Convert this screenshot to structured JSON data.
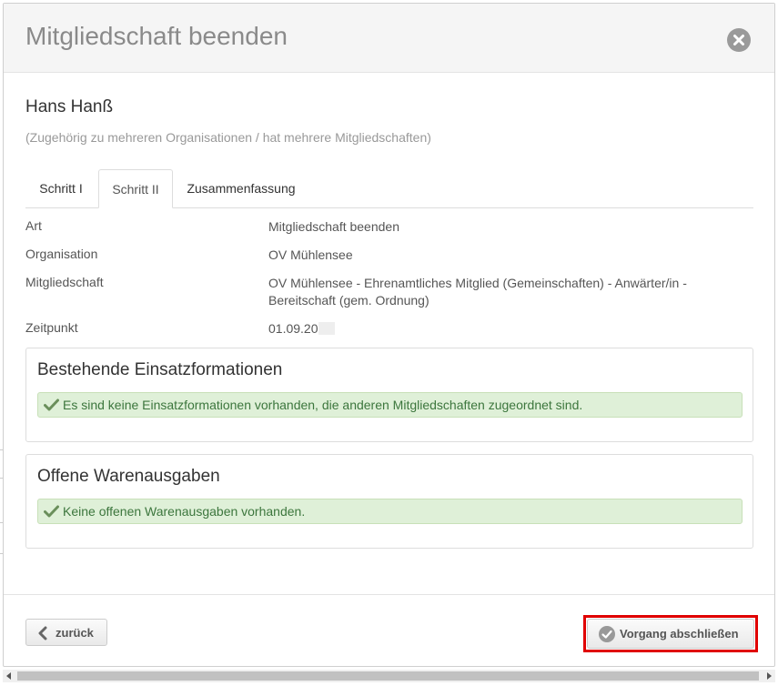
{
  "dialog": {
    "title": "Mitgliedschaft beenden",
    "close_icon": "close-icon"
  },
  "person": {
    "name": "Hans Hanß",
    "subtitle": "(Zugehörig zu mehreren Organisationen / hat mehrere Mitgliedschaften)"
  },
  "tabs": [
    {
      "label": "Schritt I",
      "active": false
    },
    {
      "label": "Schritt II",
      "active": true
    },
    {
      "label": "Zusammenfassung",
      "active": false
    }
  ],
  "details": {
    "art": {
      "label": "Art",
      "value": "Mitgliedschaft beenden"
    },
    "organisation": {
      "label": "Organisation",
      "value": "OV Mühlensee"
    },
    "mitgliedschaft": {
      "label": "Mitgliedschaft",
      "value": "OV Mühlensee - Ehrenamtliches Mitglied (Gemeinschaften) - Anwärter/in - Bereitschaft (gem. Ordnung)"
    },
    "zeitpunkt": {
      "label": "Zeitpunkt",
      "value": "01.09.20"
    }
  },
  "panels": {
    "einsatz": {
      "title": "Bestehende Einsatzformationen",
      "message": "Es sind keine Einsatzformationen vorhanden, die anderen Mitgliedschaften zugeordnet sind."
    },
    "waren": {
      "title": "Offene Warenausgaben",
      "message": "Keine offenen Warenausgaben vorhanden."
    }
  },
  "footer": {
    "back_label": "zurück",
    "finish_label": "Vorgang abschließen"
  },
  "colors": {
    "success_bg": "#dff0d8",
    "success_text": "#3c763d",
    "highlight": "#e00000"
  }
}
